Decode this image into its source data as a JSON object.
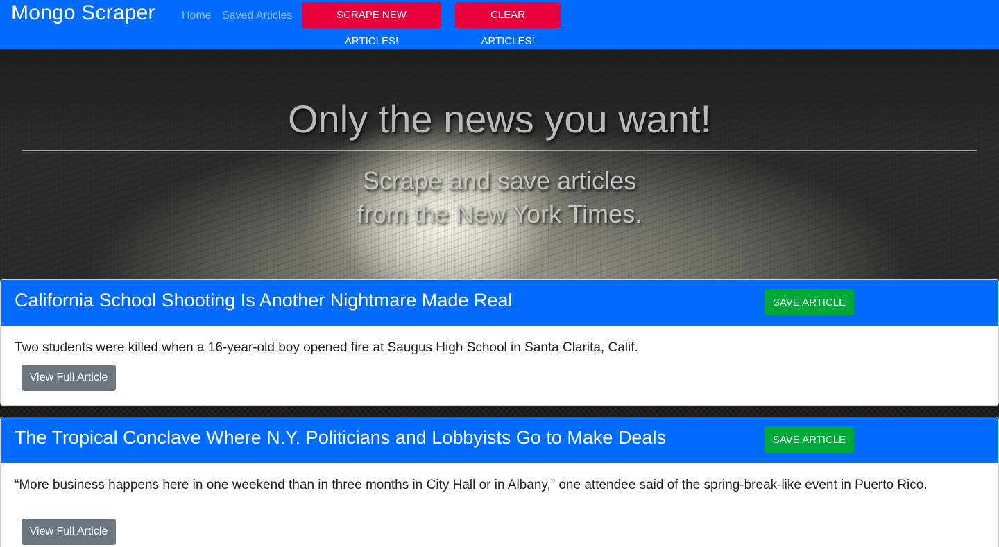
{
  "navbar": {
    "brand": "Mongo Scraper",
    "links": [
      "Home",
      "Saved Articles"
    ],
    "scrape_button": "SCRAPE NEW ARTICLES!",
    "clear_button": "CLEAR ARTICLES!"
  },
  "hero": {
    "title": "Only the news you want!",
    "subtitle_line1": "Scrape and save articles",
    "subtitle_line2": "from the New York Times."
  },
  "articles": [
    {
      "title": "California School Shooting Is Another Nightmare Made Real",
      "summary": "Two students were killed when a 16-year-old boy opened fire at Saugus High School in Santa Clarita, Calif.",
      "save_label": "SAVE ARTICLE",
      "view_label": "View Full Article"
    },
    {
      "title": "The Tropical Conclave Where N.Y. Politicians and Lobbyists Go to Make Deals",
      "summary": "“More business happens here in one weekend than in three months in City Hall or in Albany,” one attendee said of the spring-break-like event in Puerto Rico.",
      "save_label": "SAVE ARTICLE",
      "view_label": "View Full Article"
    }
  ],
  "colors": {
    "primary": "#006cff",
    "danger": "#e8003c",
    "success": "#00a83a",
    "secondary": "#6c757d"
  }
}
